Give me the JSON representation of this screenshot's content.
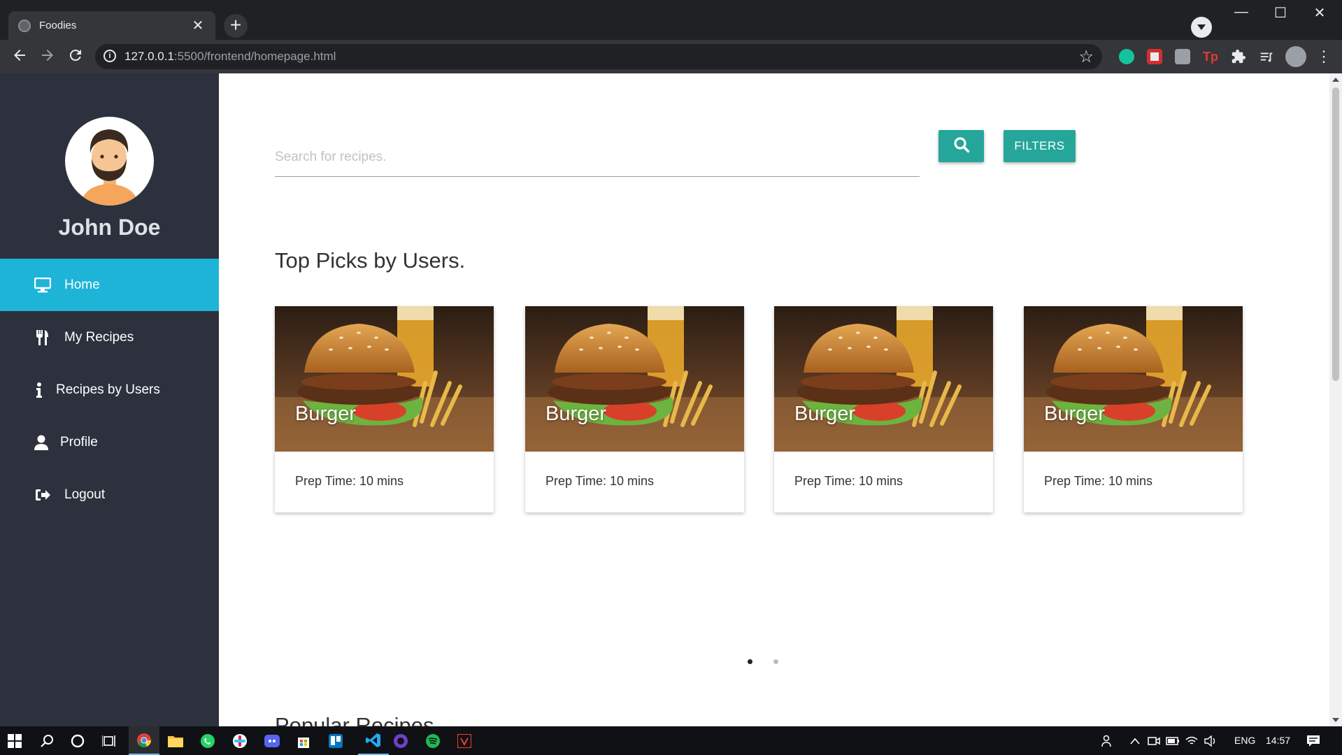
{
  "browser": {
    "tab_title": "Foodies",
    "tab_close": "✕",
    "new_tab": "+",
    "url_host": "127.0.0.1",
    "url_path": ":5500/frontend/homepage.html",
    "window_controls": [
      "—",
      "☐",
      "✕"
    ]
  },
  "sidebar": {
    "user_name": "John Doe",
    "items": [
      {
        "label": "Home",
        "icon": "monitor-icon",
        "active": true
      },
      {
        "label": "My Recipes",
        "icon": "utensils-icon",
        "active": false
      },
      {
        "label": "Recipes by Users",
        "icon": "info-icon",
        "active": false
      },
      {
        "label": "Profile",
        "icon": "user-icon",
        "active": false
      },
      {
        "label": "Logout",
        "icon": "sign-out-icon",
        "active": false
      }
    ]
  },
  "search": {
    "placeholder": "Search for recipes.",
    "button_icon": "search-icon",
    "filters_label": "FILTERS"
  },
  "top_picks": {
    "title": "Top Picks by Users.",
    "cards": [
      {
        "title": "Burger",
        "prep_time": "Prep Time: 10 mins"
      },
      {
        "title": "Burger",
        "prep_time": "Prep Time: 10 mins"
      },
      {
        "title": "Burger",
        "prep_time": "Prep Time: 10 mins"
      },
      {
        "title": "Burger",
        "prep_time": "Prep Time: 10 mins"
      }
    ],
    "carousel_pages": 2,
    "carousel_active": 1
  },
  "popular": {
    "title": "Popular Recipes"
  },
  "colors": {
    "sidebar_bg": "#2d313d",
    "active_item": "#1db4d8",
    "teal_button": "#26a69a"
  },
  "taskbar": {
    "language": "ENG",
    "time": "14:57"
  }
}
